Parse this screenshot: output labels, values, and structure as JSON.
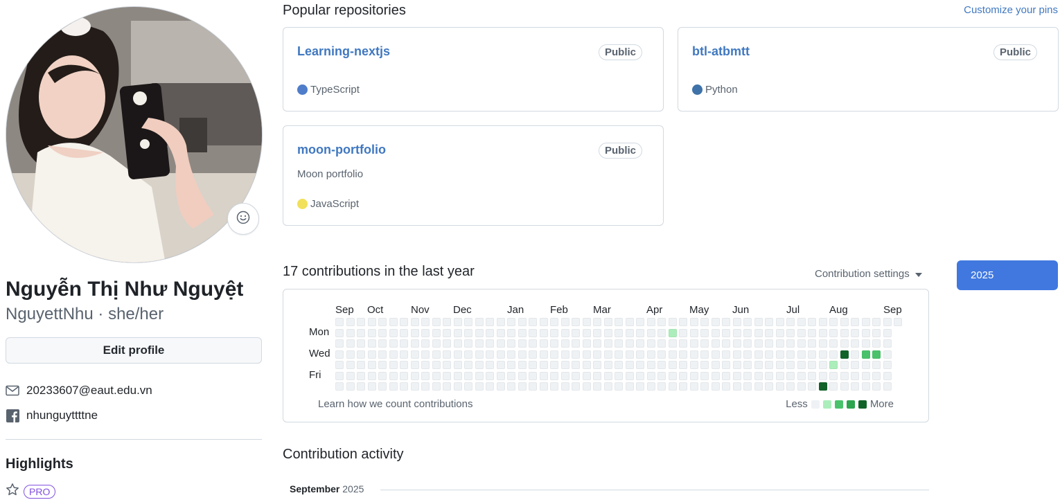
{
  "profile": {
    "name": "Nguyễn Thị Như Nguyệt",
    "username_line": "NguyettNhu · she/her",
    "edit_label": "Edit profile",
    "email": "20233607@eaut.edu.vn",
    "facebook": "nhunguyttttne",
    "highlights_title": "Highlights",
    "pro_label": "PRO"
  },
  "repos": {
    "title": "Popular repositories",
    "customize_label": "Customize your pins",
    "items": [
      {
        "name": "Learning-nextjs",
        "badge": "Public",
        "description": "",
        "language": "TypeScript",
        "lang_color": "#4f7dc9"
      },
      {
        "name": "btl-atbmtt",
        "badge": "Public",
        "description": "",
        "language": "Python",
        "lang_color": "#3f72a8"
      },
      {
        "name": "moon-portfolio",
        "badge": "Public",
        "description": "Moon portfolio",
        "language": "JavaScript",
        "lang_color": "#f1e05a"
      }
    ]
  },
  "contributions": {
    "title": "17 contributions in the last year",
    "settings_label": "Contribution settings",
    "year": "2025",
    "months": [
      "Sep",
      "Oct",
      "Nov",
      "Dec",
      "Jan",
      "Feb",
      "Mar",
      "Apr",
      "May",
      "Jun",
      "Jul",
      "Aug",
      "Sep"
    ],
    "days": [
      "Mon",
      "Wed",
      "Fri"
    ],
    "learn_label": "Learn how we count contributions",
    "legend_less": "Less",
    "legend_more": "More",
    "colors": [
      "#eff2f5",
      "#aceebb",
      "#4ac26b",
      "#2da44e",
      "#116329"
    ],
    "active_cells": [
      {
        "week": 31,
        "day": 1,
        "level": 1
      },
      {
        "week": 47,
        "day": 3,
        "level": 4
      },
      {
        "week": 46,
        "day": 4,
        "level": 1
      },
      {
        "week": 49,
        "day": 3,
        "level": 2
      },
      {
        "week": 50,
        "day": 3,
        "level": 2
      },
      {
        "week": 45,
        "day": 6,
        "level": 4
      }
    ]
  },
  "activity": {
    "title": "Contribution activity",
    "month": "September",
    "year": "2025"
  }
}
